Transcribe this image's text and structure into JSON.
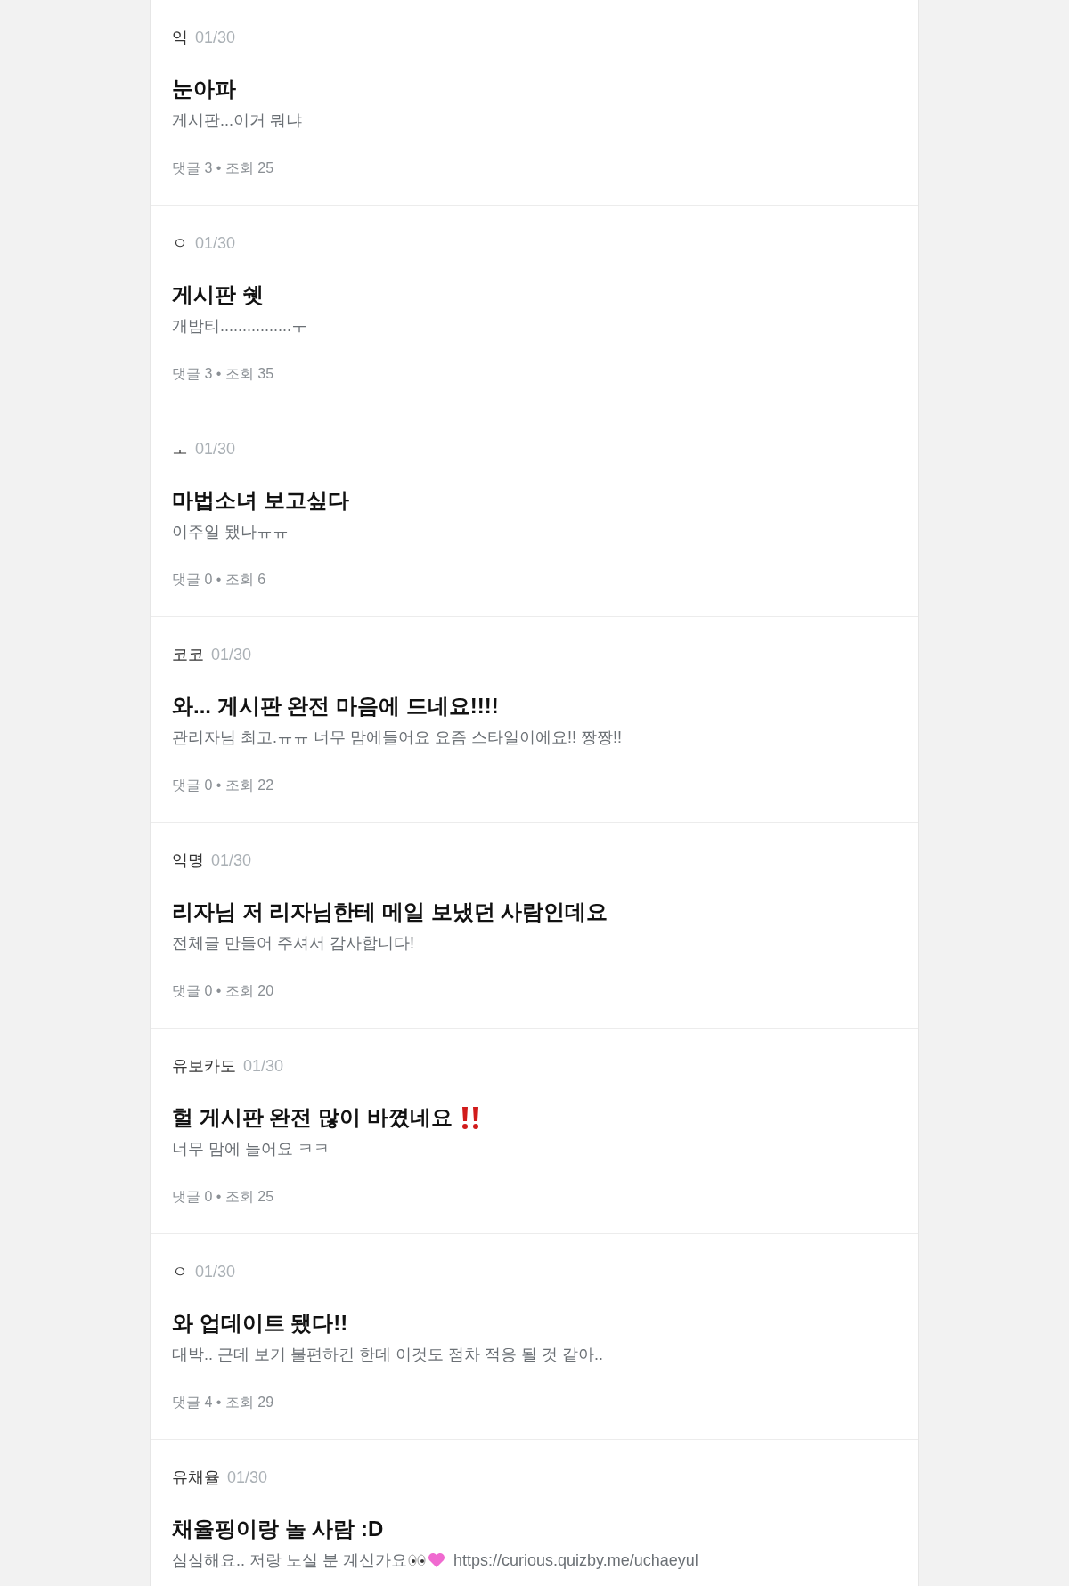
{
  "posts": [
    {
      "author": "익",
      "date": "01/30",
      "title": "눈아파",
      "body": "게시판...이거 뭐냐",
      "meta": "댓글 3 • 조회 25"
    },
    {
      "author": "ㅇ",
      "date": "01/30",
      "title": "게시판 쉣",
      "body": "개밤티................ㅜ",
      "meta": "댓글 3 • 조회 35"
    },
    {
      "author": "ㅗ",
      "date": "01/30",
      "title": "마법소녀 보고싶다",
      "body": "이주일 됐나ㅠㅠ",
      "meta": "댓글 0 • 조회 6"
    },
    {
      "author": "코코",
      "date": "01/30",
      "title": "와... 게시판 완전 마음에 드네요!!!!",
      "body": "관리자님 최고.ㅠㅠ 너무 맘에들어요 요즘 스타일이에요!! 짱짱!!",
      "meta": "댓글 0 • 조회 22"
    },
    {
      "author": "익명",
      "date": "01/30",
      "title": "리자님 저 리자님한테 메일 보냈던 사람인데요",
      "body": "전체글 만들어 주셔서 감사합니다!",
      "meta": "댓글 0 • 조회 20"
    },
    {
      "author": "유보카도",
      "date": "01/30",
      "title": "헐 게시판 완전 많이 바꼈네요",
      "title_icon": {
        "kind": "exclamation"
      },
      "body": "너무 맘에 들어요 ㅋㅋ",
      "meta": "댓글 0 • 조회 25"
    },
    {
      "author": "ㅇ",
      "date": "01/30",
      "title": "와 업데이트 됐다!!",
      "body": "대박.. 근데 보기 불편하긴 한데 이것도 점차 적응 될 것 같아..",
      "meta": "댓글 4 • 조회 29"
    },
    {
      "author": "유채율",
      "date": "01/30",
      "title": "채율핑이랑 놀 사람 :D",
      "body": "심심해요.. 저랑 노실 분 계신가요",
      "body_icons": [
        {
          "kind": "eyes"
        },
        {
          "kind": "heart"
        }
      ],
      "link": "https://curious.quizby.me/uchaeyul"
    }
  ]
}
